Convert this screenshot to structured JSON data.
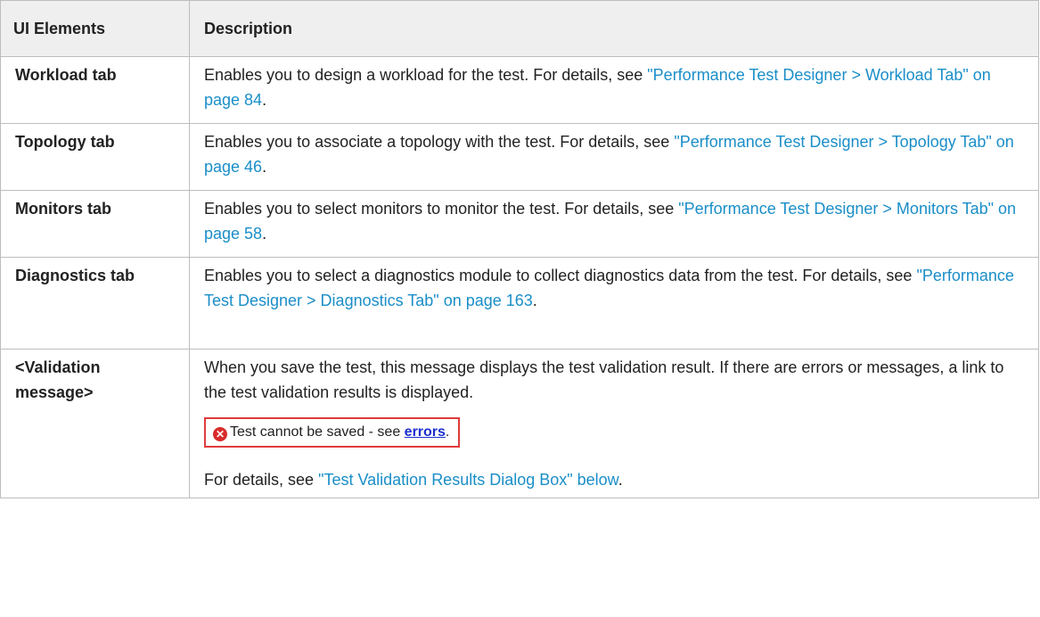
{
  "header": {
    "col1": "UI Elements",
    "col2": "Description"
  },
  "rows": [
    {
      "name": "Workload tab",
      "text": "Enables you to design a workload for the test. For details, see ",
      "link": "\"Performance Test Designer > Workload Tab\" on page 84",
      "after": "."
    },
    {
      "name": "Topology tab",
      "text": "Enables you to associate a topology with the test. For details, see ",
      "link": "\"Performance Test Designer > Topology Tab\" on page 46",
      "after": "."
    },
    {
      "name": "Monitors tab",
      "text": "Enables you to select monitors to monitor the test. For details, see ",
      "link": "\"Performance Test Designer > Monitors Tab\" on page 58",
      "after": "."
    },
    {
      "name": "Diagnostics tab",
      "text": "Enables you to select a diagnostics module to collect diagnostics data from the test. For details, see ",
      "link": "\"Performance Test Designer > Diagnostics Tab\" on page 163",
      "after": "."
    },
    {
      "name": "<Validation message>",
      "text": "When you save the test, this message displays the test validation result. If there are errors or messages, a link to the test validation results is displayed.",
      "error_box": {
        "text": "Test cannot be saved - see ",
        "link": "errors",
        "after": ".",
        "icon": "error-icon"
      },
      "details_text": "For details, see ",
      "details_link": "\"Test Validation Results Dialog Box\" below",
      "details_after": "."
    }
  ]
}
